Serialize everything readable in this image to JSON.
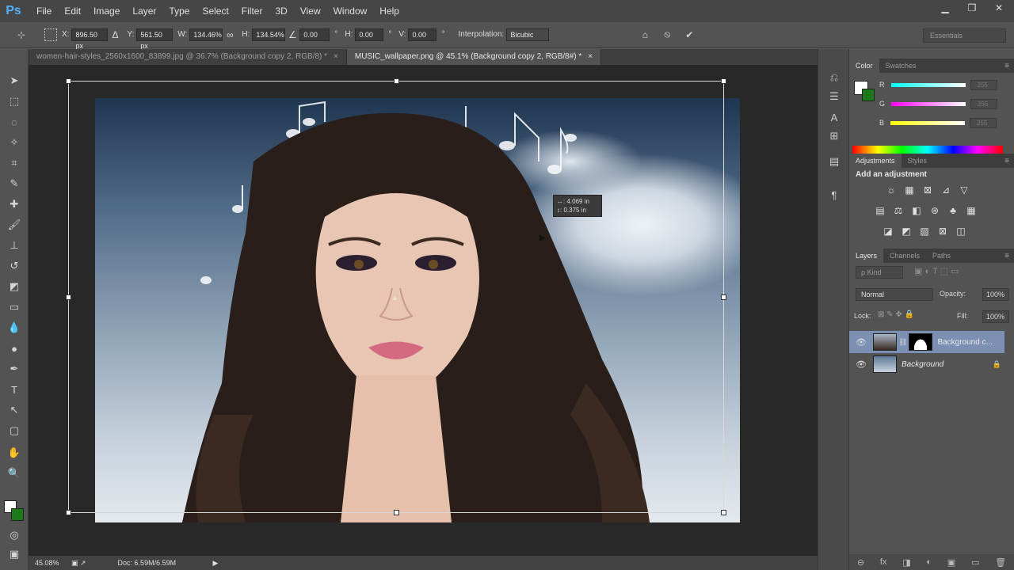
{
  "app": {
    "logo": "Ps"
  },
  "menu": [
    "File",
    "Edit",
    "Image",
    "Layer",
    "Type",
    "Select",
    "Filter",
    "3D",
    "View",
    "Window",
    "Help"
  ],
  "window_controls": {
    "minimize": "▁",
    "restore": "❐",
    "close": "✕"
  },
  "options": {
    "x_label": "X:",
    "x_value": "896.50 px",
    "delta_icon": "Δ",
    "y_label": "Y:",
    "y_value": "561.50 px",
    "w_label": "W:",
    "w_value": "134.46%",
    "link_icon": "∞",
    "h_label": "H:",
    "h_value": "134.54%",
    "angle_icon": "∠",
    "angle_value": "0.00",
    "deg": "°",
    "hs_label": "H:",
    "hs_value": "0.00",
    "vs_label": "V:",
    "vs_value": "0.00",
    "interp_label": "Interpolation:",
    "interp_value": "Bicubic",
    "cancel_icon": "⦸",
    "commit_icon": "✔",
    "warp_icon": "⌂"
  },
  "workspace": "Essentials",
  "tabs": [
    {
      "label": "women-hair-styles_2560x1600_83899.jpg @ 36.7% (Background copy 2, RGB/8) *",
      "close": "×"
    },
    {
      "label": "MUSIC_wallpaper.png @ 45.1% (Background copy 2, RGB/8#) *",
      "close": "×"
    }
  ],
  "transform_readout": {
    "w": "↔: 4.069 in",
    "h": "↕: 0.375 in"
  },
  "status": {
    "zoom": "45.08%",
    "doc": "Doc: 6.59M/6.59M",
    "arrow": "▶"
  },
  "color_panel": {
    "tabs": [
      "Color",
      "Swatches"
    ],
    "channels": [
      {
        "name": "R",
        "value": "255",
        "color": "#4de3ea"
      },
      {
        "name": "G",
        "value": "255",
        "color": "#f06be6"
      },
      {
        "name": "B",
        "value": "255",
        "color": "#f1ef43"
      }
    ]
  },
  "adjustments": {
    "tabs": [
      "Adjustments",
      "Styles"
    ],
    "title": "Add an adjustment",
    "row1": [
      "☼",
      "▦",
      "⊠",
      "⊿",
      "▽"
    ],
    "row2": [
      "▤",
      "⚖",
      "◧",
      "⊛",
      "♣",
      "▦"
    ],
    "row3": [
      "◪",
      "◩",
      "▨",
      "⊠",
      "◫"
    ]
  },
  "layers": {
    "tabs": [
      "Layers",
      "Channels",
      "Paths"
    ],
    "kind": "ρ Kind",
    "blend": "Normal",
    "opacity_label": "Opacity:",
    "opacity_value": "100%",
    "lock_label": "Lock:",
    "fill_label": "Fill:",
    "fill_value": "100%",
    "items": [
      {
        "name": "Background c...",
        "eye": "👁"
      },
      {
        "name": "Background",
        "eye": "👁",
        "lock": "🔒"
      }
    ],
    "bottom_icons": [
      "⊖",
      "fx",
      "◨",
      "◐",
      "▣",
      "▭",
      "🗑"
    ]
  },
  "panel_menu": "≡",
  "colors": {
    "accent": "#4fb0ff",
    "selected_layer": "#7c90b4"
  }
}
